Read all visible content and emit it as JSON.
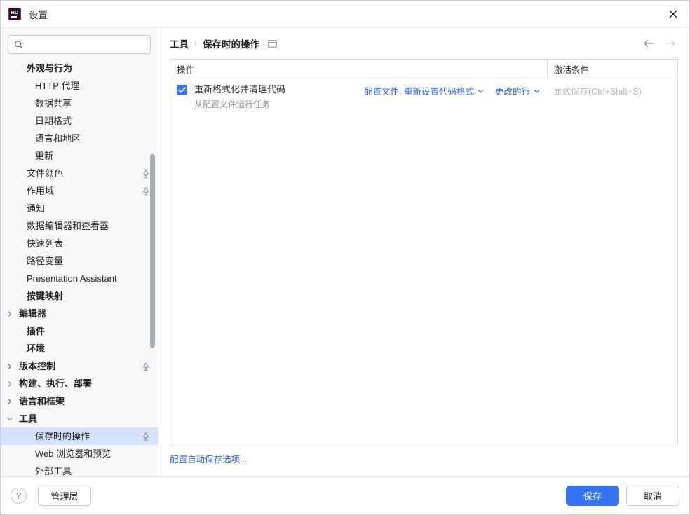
{
  "window": {
    "title": "设置",
    "logo_text": "RD",
    "close_icon": "close-icon"
  },
  "search": {
    "value": "",
    "placeholder": ""
  },
  "sidebar": {
    "items": [
      {
        "label": "外观与行为",
        "level": 0,
        "group": true,
        "twisty": "",
        "marker": false
      },
      {
        "label": "HTTP 代理",
        "level": 1,
        "group": false,
        "twisty": "",
        "marker": false
      },
      {
        "label": "数据共享",
        "level": 1,
        "group": false,
        "twisty": "",
        "marker": false
      },
      {
        "label": "日期格式",
        "level": 1,
        "group": false,
        "twisty": "",
        "marker": false
      },
      {
        "label": "语言和地区",
        "level": 1,
        "group": false,
        "twisty": "",
        "marker": false
      },
      {
        "label": "更新",
        "level": 1,
        "group": false,
        "twisty": "",
        "marker": false
      },
      {
        "label": "文件颜色",
        "level": 0,
        "group": false,
        "twisty": "",
        "marker": true
      },
      {
        "label": "作用域",
        "level": 0,
        "group": false,
        "twisty": "",
        "marker": true
      },
      {
        "label": "通知",
        "level": 0,
        "group": false,
        "twisty": "",
        "marker": false
      },
      {
        "label": "数据编辑器和查看器",
        "level": 0,
        "group": false,
        "twisty": "",
        "marker": false
      },
      {
        "label": "快速列表",
        "level": 0,
        "group": false,
        "twisty": "",
        "marker": false
      },
      {
        "label": "路径变量",
        "level": 0,
        "group": false,
        "twisty": "",
        "marker": false
      },
      {
        "label": "Presentation Assistant",
        "level": 0,
        "group": false,
        "twisty": "",
        "marker": false
      },
      {
        "label": "按键映射",
        "level": 0,
        "group": true,
        "twisty": "",
        "marker": false
      },
      {
        "label": "编辑器",
        "level": 0,
        "group": true,
        "twisty": "right",
        "marker": false
      },
      {
        "label": "插件",
        "level": 0,
        "group": true,
        "twisty": "",
        "marker": false
      },
      {
        "label": "环境",
        "level": 0,
        "group": true,
        "twisty": "",
        "marker": false
      },
      {
        "label": "版本控制",
        "level": 0,
        "group": true,
        "twisty": "right",
        "marker": true
      },
      {
        "label": "构建、执行、部署",
        "level": 0,
        "group": true,
        "twisty": "right",
        "marker": false
      },
      {
        "label": "语言和框架",
        "level": 0,
        "group": true,
        "twisty": "right",
        "marker": false
      },
      {
        "label": "工具",
        "level": 0,
        "group": true,
        "twisty": "down",
        "marker": false
      },
      {
        "label": "保存时的操作",
        "level": 1,
        "group": false,
        "twisty": "",
        "marker": true,
        "selected": true
      },
      {
        "label": "Web 浏览器和预览",
        "level": 1,
        "group": false,
        "twisty": "",
        "marker": false
      },
      {
        "label": "外部工具",
        "level": 1,
        "group": false,
        "twisty": "",
        "marker": false
      }
    ]
  },
  "breadcrumb": {
    "root": "工具",
    "separator": "›",
    "current": "保存时的操作",
    "panel_icon": "window-icon"
  },
  "nav": {
    "back_icon": "arrow-left-icon",
    "forward_icon": "arrow-right-icon"
  },
  "table": {
    "columns": {
      "action": "操作",
      "condition": "激活条件"
    },
    "rows": [
      {
        "checked": true,
        "title": "重新格式化并清理代码",
        "subtitle": "从配置文件运行任务",
        "controls": [
          {
            "label": "配置文件: 重新设置代码格式",
            "chevron": "chevron-down-icon"
          },
          {
            "label": "更改的行",
            "chevron": "chevron-down-icon"
          }
        ],
        "condition": "显式保存(Ctrl+Shift+S)"
      }
    ]
  },
  "links": {
    "configure_autosave": "配置自动保存选项..."
  },
  "footer": {
    "help_label": "?",
    "manage_label": "管理层",
    "save_label": "保存",
    "cancel_label": "取消"
  },
  "colors": {
    "accent": "#3574f0",
    "link": "#2e62cc",
    "selection": "#d4e2ff",
    "logo_border": "#d6007f",
    "disabled_text": "#b0b3ba"
  }
}
